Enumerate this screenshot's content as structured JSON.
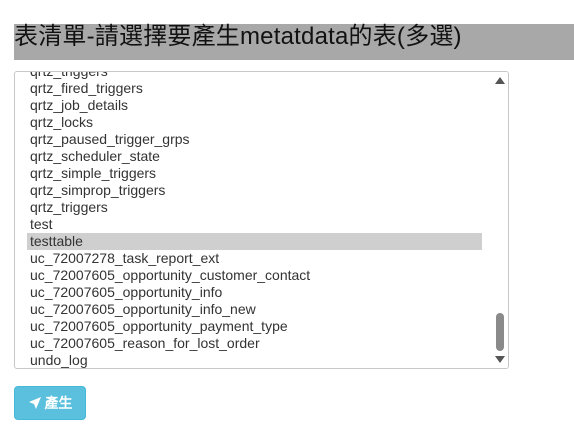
{
  "header": {
    "title": "表清單-請選擇要產生metatdata的表(多選)"
  },
  "table_list": {
    "partial_top_item": "qrtz_triggers",
    "items": [
      {
        "label": "qrtz_fired_triggers",
        "selected": false
      },
      {
        "label": "qrtz_job_details",
        "selected": false
      },
      {
        "label": "qrtz_locks",
        "selected": false
      },
      {
        "label": "qrtz_paused_trigger_grps",
        "selected": false
      },
      {
        "label": "qrtz_scheduler_state",
        "selected": false
      },
      {
        "label": "qrtz_simple_triggers",
        "selected": false
      },
      {
        "label": "qrtz_simprop_triggers",
        "selected": false
      },
      {
        "label": "qrtz_triggers",
        "selected": false
      },
      {
        "label": "test",
        "selected": false
      },
      {
        "label": "testtable",
        "selected": true
      },
      {
        "label": "uc_72007278_task_report_ext",
        "selected": false
      },
      {
        "label": "uc_72007605_opportunity_customer_contact",
        "selected": false
      },
      {
        "label": "uc_72007605_opportunity_info",
        "selected": false
      },
      {
        "label": "uc_72007605_opportunity_info_new",
        "selected": false
      },
      {
        "label": "uc_72007605_opportunity_payment_type",
        "selected": false
      },
      {
        "label": "uc_72007605_reason_for_lost_order",
        "selected": false
      },
      {
        "label": "undo_log",
        "selected": false
      }
    ]
  },
  "actions": {
    "generate_label": "產生",
    "generate_icon": "send-icon"
  },
  "colors": {
    "title_bar": "#a8a8a8",
    "button_bg": "#5bc0de",
    "selected_row": "#cfcfcf"
  }
}
